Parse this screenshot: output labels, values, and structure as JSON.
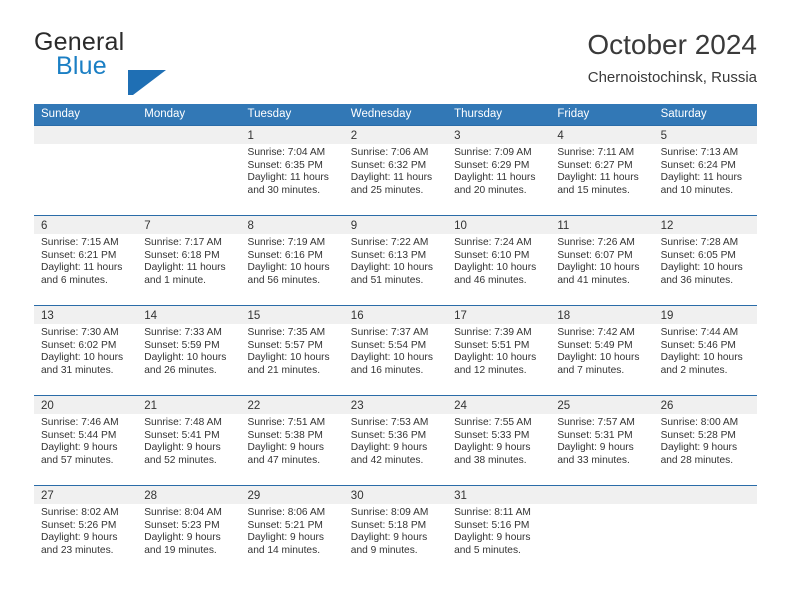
{
  "brand": {
    "name_part1": "General",
    "name_part2": "Blue",
    "mark": "triangle-logo"
  },
  "header": {
    "title": "October 2024",
    "location": "Chernoistochinsk, Russia"
  },
  "calendar": {
    "weekdays": [
      "Sunday",
      "Monday",
      "Tuesday",
      "Wednesday",
      "Thursday",
      "Friday",
      "Saturday"
    ],
    "colors": {
      "header_blue": "#3278b6",
      "row_divider_blue": "#2a6ca8",
      "day_band_gray": "#f0f0f0",
      "brand_blue": "#1b7fc4",
      "text": "#333333"
    },
    "weeks": [
      [
        {
          "day": "",
          "sunrise": "",
          "sunset": "",
          "daylight_line1": "",
          "daylight_line2": ""
        },
        {
          "day": "",
          "sunrise": "",
          "sunset": "",
          "daylight_line1": "",
          "daylight_line2": ""
        },
        {
          "day": "1",
          "sunrise": "Sunrise: 7:04 AM",
          "sunset": "Sunset: 6:35 PM",
          "daylight_line1": "Daylight: 11 hours",
          "daylight_line2": "and 30 minutes."
        },
        {
          "day": "2",
          "sunrise": "Sunrise: 7:06 AM",
          "sunset": "Sunset: 6:32 PM",
          "daylight_line1": "Daylight: 11 hours",
          "daylight_line2": "and 25 minutes."
        },
        {
          "day": "3",
          "sunrise": "Sunrise: 7:09 AM",
          "sunset": "Sunset: 6:29 PM",
          "daylight_line1": "Daylight: 11 hours",
          "daylight_line2": "and 20 minutes."
        },
        {
          "day": "4",
          "sunrise": "Sunrise: 7:11 AM",
          "sunset": "Sunset: 6:27 PM",
          "daylight_line1": "Daylight: 11 hours",
          "daylight_line2": "and 15 minutes."
        },
        {
          "day": "5",
          "sunrise": "Sunrise: 7:13 AM",
          "sunset": "Sunset: 6:24 PM",
          "daylight_line1": "Daylight: 11 hours",
          "daylight_line2": "and 10 minutes."
        }
      ],
      [
        {
          "day": "6",
          "sunrise": "Sunrise: 7:15 AM",
          "sunset": "Sunset: 6:21 PM",
          "daylight_line1": "Daylight: 11 hours",
          "daylight_line2": "and 6 minutes."
        },
        {
          "day": "7",
          "sunrise": "Sunrise: 7:17 AM",
          "sunset": "Sunset: 6:18 PM",
          "daylight_line1": "Daylight: 11 hours",
          "daylight_line2": "and 1 minute."
        },
        {
          "day": "8",
          "sunrise": "Sunrise: 7:19 AM",
          "sunset": "Sunset: 6:16 PM",
          "daylight_line1": "Daylight: 10 hours",
          "daylight_line2": "and 56 minutes."
        },
        {
          "day": "9",
          "sunrise": "Sunrise: 7:22 AM",
          "sunset": "Sunset: 6:13 PM",
          "daylight_line1": "Daylight: 10 hours",
          "daylight_line2": "and 51 minutes."
        },
        {
          "day": "10",
          "sunrise": "Sunrise: 7:24 AM",
          "sunset": "Sunset: 6:10 PM",
          "daylight_line1": "Daylight: 10 hours",
          "daylight_line2": "and 46 minutes."
        },
        {
          "day": "11",
          "sunrise": "Sunrise: 7:26 AM",
          "sunset": "Sunset: 6:07 PM",
          "daylight_line1": "Daylight: 10 hours",
          "daylight_line2": "and 41 minutes."
        },
        {
          "day": "12",
          "sunrise": "Sunrise: 7:28 AM",
          "sunset": "Sunset: 6:05 PM",
          "daylight_line1": "Daylight: 10 hours",
          "daylight_line2": "and 36 minutes."
        }
      ],
      [
        {
          "day": "13",
          "sunrise": "Sunrise: 7:30 AM",
          "sunset": "Sunset: 6:02 PM",
          "daylight_line1": "Daylight: 10 hours",
          "daylight_line2": "and 31 minutes."
        },
        {
          "day": "14",
          "sunrise": "Sunrise: 7:33 AM",
          "sunset": "Sunset: 5:59 PM",
          "daylight_line1": "Daylight: 10 hours",
          "daylight_line2": "and 26 minutes."
        },
        {
          "day": "15",
          "sunrise": "Sunrise: 7:35 AM",
          "sunset": "Sunset: 5:57 PM",
          "daylight_line1": "Daylight: 10 hours",
          "daylight_line2": "and 21 minutes."
        },
        {
          "day": "16",
          "sunrise": "Sunrise: 7:37 AM",
          "sunset": "Sunset: 5:54 PM",
          "daylight_line1": "Daylight: 10 hours",
          "daylight_line2": "and 16 minutes."
        },
        {
          "day": "17",
          "sunrise": "Sunrise: 7:39 AM",
          "sunset": "Sunset: 5:51 PM",
          "daylight_line1": "Daylight: 10 hours",
          "daylight_line2": "and 12 minutes."
        },
        {
          "day": "18",
          "sunrise": "Sunrise: 7:42 AM",
          "sunset": "Sunset: 5:49 PM",
          "daylight_line1": "Daylight: 10 hours",
          "daylight_line2": "and 7 minutes."
        },
        {
          "day": "19",
          "sunrise": "Sunrise: 7:44 AM",
          "sunset": "Sunset: 5:46 PM",
          "daylight_line1": "Daylight: 10 hours",
          "daylight_line2": "and 2 minutes."
        }
      ],
      [
        {
          "day": "20",
          "sunrise": "Sunrise: 7:46 AM",
          "sunset": "Sunset: 5:44 PM",
          "daylight_line1": "Daylight: 9 hours",
          "daylight_line2": "and 57 minutes."
        },
        {
          "day": "21",
          "sunrise": "Sunrise: 7:48 AM",
          "sunset": "Sunset: 5:41 PM",
          "daylight_line1": "Daylight: 9 hours",
          "daylight_line2": "and 52 minutes."
        },
        {
          "day": "22",
          "sunrise": "Sunrise: 7:51 AM",
          "sunset": "Sunset: 5:38 PM",
          "daylight_line1": "Daylight: 9 hours",
          "daylight_line2": "and 47 minutes."
        },
        {
          "day": "23",
          "sunrise": "Sunrise: 7:53 AM",
          "sunset": "Sunset: 5:36 PM",
          "daylight_line1": "Daylight: 9 hours",
          "daylight_line2": "and 42 minutes."
        },
        {
          "day": "24",
          "sunrise": "Sunrise: 7:55 AM",
          "sunset": "Sunset: 5:33 PM",
          "daylight_line1": "Daylight: 9 hours",
          "daylight_line2": "and 38 minutes."
        },
        {
          "day": "25",
          "sunrise": "Sunrise: 7:57 AM",
          "sunset": "Sunset: 5:31 PM",
          "daylight_line1": "Daylight: 9 hours",
          "daylight_line2": "and 33 minutes."
        },
        {
          "day": "26",
          "sunrise": "Sunrise: 8:00 AM",
          "sunset": "Sunset: 5:28 PM",
          "daylight_line1": "Daylight: 9 hours",
          "daylight_line2": "and 28 minutes."
        }
      ],
      [
        {
          "day": "27",
          "sunrise": "Sunrise: 8:02 AM",
          "sunset": "Sunset: 5:26 PM",
          "daylight_line1": "Daylight: 9 hours",
          "daylight_line2": "and 23 minutes."
        },
        {
          "day": "28",
          "sunrise": "Sunrise: 8:04 AM",
          "sunset": "Sunset: 5:23 PM",
          "daylight_line1": "Daylight: 9 hours",
          "daylight_line2": "and 19 minutes."
        },
        {
          "day": "29",
          "sunrise": "Sunrise: 8:06 AM",
          "sunset": "Sunset: 5:21 PM",
          "daylight_line1": "Daylight: 9 hours",
          "daylight_line2": "and 14 minutes."
        },
        {
          "day": "30",
          "sunrise": "Sunrise: 8:09 AM",
          "sunset": "Sunset: 5:18 PM",
          "daylight_line1": "Daylight: 9 hours",
          "daylight_line2": "and 9 minutes."
        },
        {
          "day": "31",
          "sunrise": "Sunrise: 8:11 AM",
          "sunset": "Sunset: 5:16 PM",
          "daylight_line1": "Daylight: 9 hours",
          "daylight_line2": "and 5 minutes."
        },
        {
          "day": "",
          "sunrise": "",
          "sunset": "",
          "daylight_line1": "",
          "daylight_line2": ""
        },
        {
          "day": "",
          "sunrise": "",
          "sunset": "",
          "daylight_line1": "",
          "daylight_line2": ""
        }
      ]
    ]
  }
}
